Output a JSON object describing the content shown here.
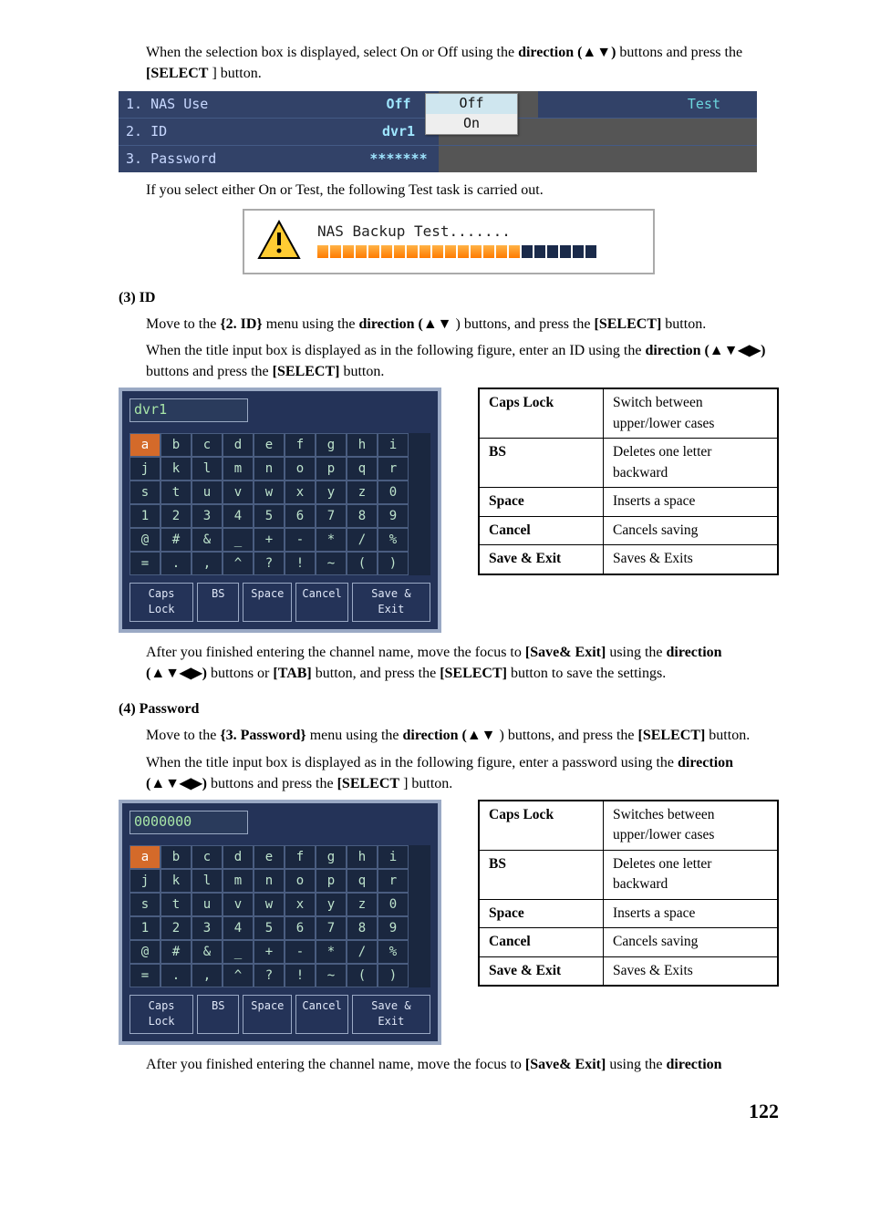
{
  "para1": {
    "t1": "When the selection box is displayed, select On or Off using the ",
    "t2": "direction (▲▼)",
    "t3": " buttons and press the ",
    "t4": "[SELECT",
    "t5": "] button."
  },
  "settings": {
    "r1_label": "1. NAS Use",
    "r1_val": "Off",
    "r1_test": "Test",
    "r2_label": "2. ID",
    "r2_val": "dvr1",
    "r3_label": "3. Password",
    "r3_val": "*******",
    "dropdown": {
      "off": "Off",
      "on": "On"
    }
  },
  "para2": "If you select either On or Test, the following Test task is carried out.",
  "alert_title": "NAS Backup Test.......",
  "progress": {
    "filled": 16,
    "empty": 6
  },
  "sec3_h": "(3) ID",
  "sec3_p1": {
    "a": "Move to the ",
    "b": "{2. ID}",
    "c": " menu using the ",
    "d": "direction (▲▼",
    "e": ") buttons, and press the ",
    "f": "[SELECT]",
    "g": " button."
  },
  "sec3_p2": {
    "a": "When the title input box is displayed as in the following figure, enter an ID using the ",
    "b": "direction (▲▼◀▶)",
    "c": " buttons and press the ",
    "d": "[SELECT]",
    "e": " button."
  },
  "kb_field_id": "dvr1",
  "kb_rows": [
    [
      "a",
      "b",
      "c",
      "d",
      "e",
      "f",
      "g",
      "h",
      "i"
    ],
    [
      "j",
      "k",
      "l",
      "m",
      "n",
      "o",
      "p",
      "q",
      "r"
    ],
    [
      "s",
      "t",
      "u",
      "v",
      "w",
      "x",
      "y",
      "z",
      "0"
    ],
    [
      "1",
      "2",
      "3",
      "4",
      "5",
      "6",
      "7",
      "8",
      "9"
    ],
    [
      "@",
      "#",
      "&",
      "_",
      "+",
      "-",
      "*",
      "/",
      "%"
    ],
    [
      "=",
      ".",
      ",",
      "^",
      "?",
      "!",
      "~",
      "(",
      ")"
    ]
  ],
  "kb_bottom": {
    "caps": "Caps Lock",
    "bs": "BS",
    "space": "Space",
    "cancel": "Cancel",
    "save": "Save & Exit"
  },
  "desc1": [
    {
      "k": "Caps Lock",
      "v": "Switch between upper/lower cases"
    },
    {
      "k": "BS",
      "v": "Deletes one letter backward"
    },
    {
      "k": "Space",
      "v": "Inserts a space"
    },
    {
      "k": "Cancel",
      "v": "Cancels saving"
    },
    {
      "k": "Save & Exit",
      "v": "Saves & Exits"
    }
  ],
  "sec3_after": {
    "a": "After you finished entering the channel name, move the focus to ",
    "b": "[Save& Exit]",
    "c": " using the ",
    "d": "direction (▲▼◀▶)",
    "e": " buttons or ",
    "f": "[TAB]",
    "g": " button, and press the ",
    "h": "[SELECT]",
    "i": " button to save the settings."
  },
  "sec4_h": "(4) Password",
  "sec4_p1": {
    "a": "Move to the ",
    "b": "{3. Password}",
    "c": " menu using the ",
    "d": "direction (▲▼",
    "e": ") buttons, and press the ",
    "f": "[SELECT]",
    "g": " button."
  },
  "sec4_p2": {
    "a": "When the title input box is displayed as in the following figure, enter a password using the ",
    "b": "direction (▲▼◀▶)",
    "c": " buttons and press the ",
    "d": "[SELECT",
    "e": "] button."
  },
  "kb_field_pw": "0000000",
  "desc2": [
    {
      "k": "Caps Lock",
      "v": "Switches between upper/lower cases"
    },
    {
      "k": "BS",
      "v": "Deletes one letter backward"
    },
    {
      "k": "Space",
      "v": "Inserts a space"
    },
    {
      "k": "Cancel",
      "v": "Cancels saving"
    },
    {
      "k": "Save & Exit",
      "v": "Saves & Exits"
    }
  ],
  "sec4_after": {
    "a": "After you finished entering the channel name, move the focus to ",
    "b": "[Save& Exit]",
    "c": " using the ",
    "d": "direction"
  },
  "page_number": "122"
}
